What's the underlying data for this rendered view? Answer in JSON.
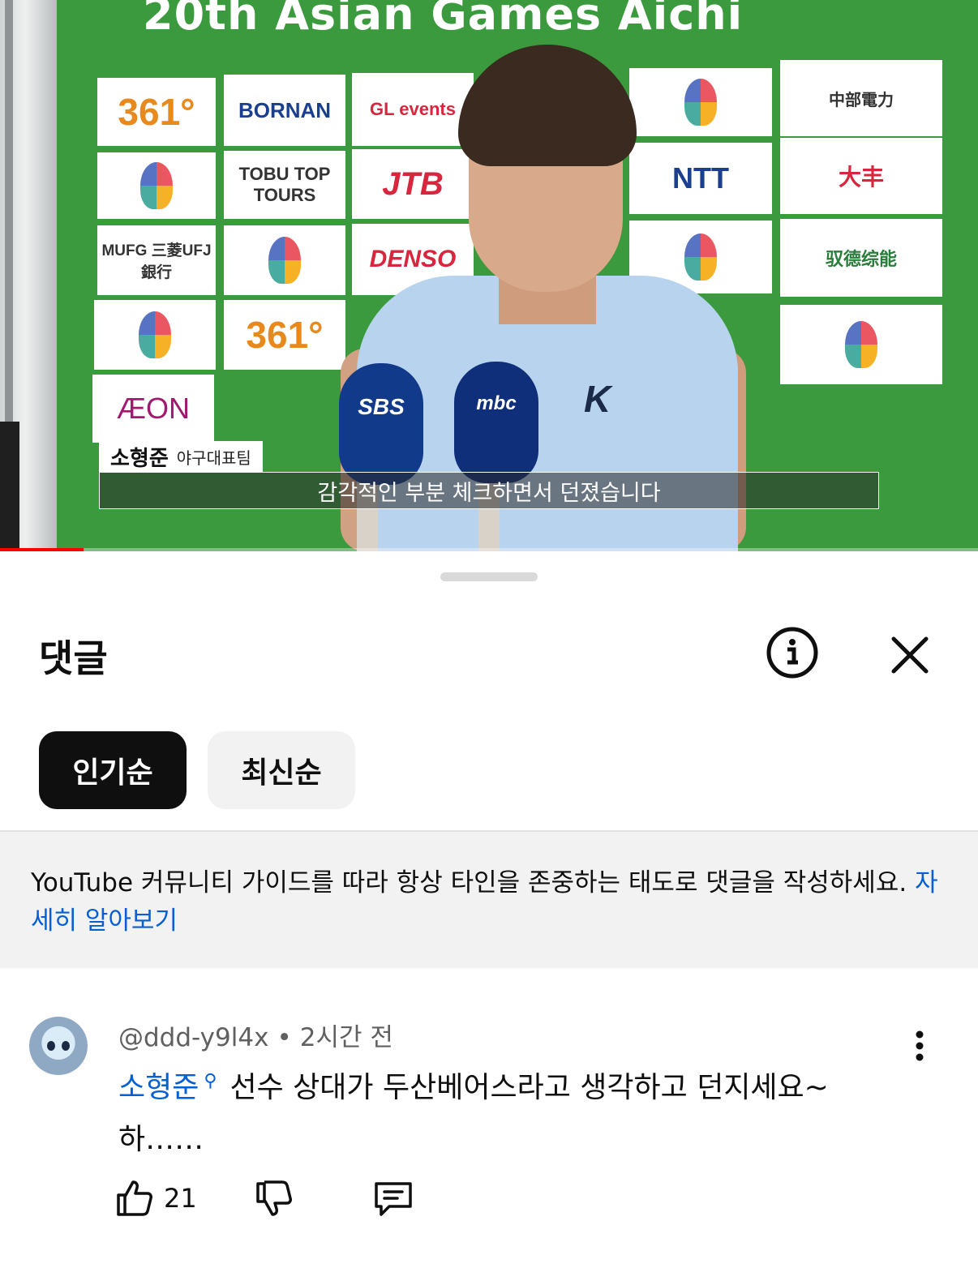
{
  "video": {
    "banner_text": "20th Asian Games Aichi",
    "sponsors": [
      "361°",
      "BORNAN",
      "GL events",
      "中部電力",
      "TOBU TOP TOURS",
      "JTB",
      "NTT",
      "大丰",
      "MUFG 三菱UFJ銀行",
      "DENSO",
      "驭德综能",
      "361°",
      "ÆON"
    ],
    "mics": [
      "SBS",
      "mbc"
    ],
    "lower_third": {
      "name": "소형준",
      "role": "야구대표팀"
    },
    "subtitle": "감각적인 부분 체크하면서 던졌습니다",
    "progress_fraction": 0.085,
    "colors": {
      "backdrop_green": "#3c9a3e",
      "progress_red": "#ff0000"
    }
  },
  "sheet": {
    "title": "댓글",
    "info_icon": "info-circle-icon",
    "close_icon": "close-icon",
    "sort_chips": [
      {
        "label": "인기순",
        "selected": true
      },
      {
        "label": "최신순",
        "selected": false
      }
    ],
    "guideline": {
      "text": "YouTube 커뮤니티 가이드를 따라 항상 타인을 존중하는 태도로 댓글을 작성하세요.",
      "link": "자세히 알아보기"
    }
  },
  "comment": {
    "author": "@ddd-y9l4x",
    "separator": "•",
    "time": "2시간 전",
    "mention": "소형준",
    "text": "선수 상대가 두산베어스라고 생각하고 던지세요~ 하……",
    "likes": "21",
    "colors": {
      "link_blue": "#065fd4"
    }
  }
}
